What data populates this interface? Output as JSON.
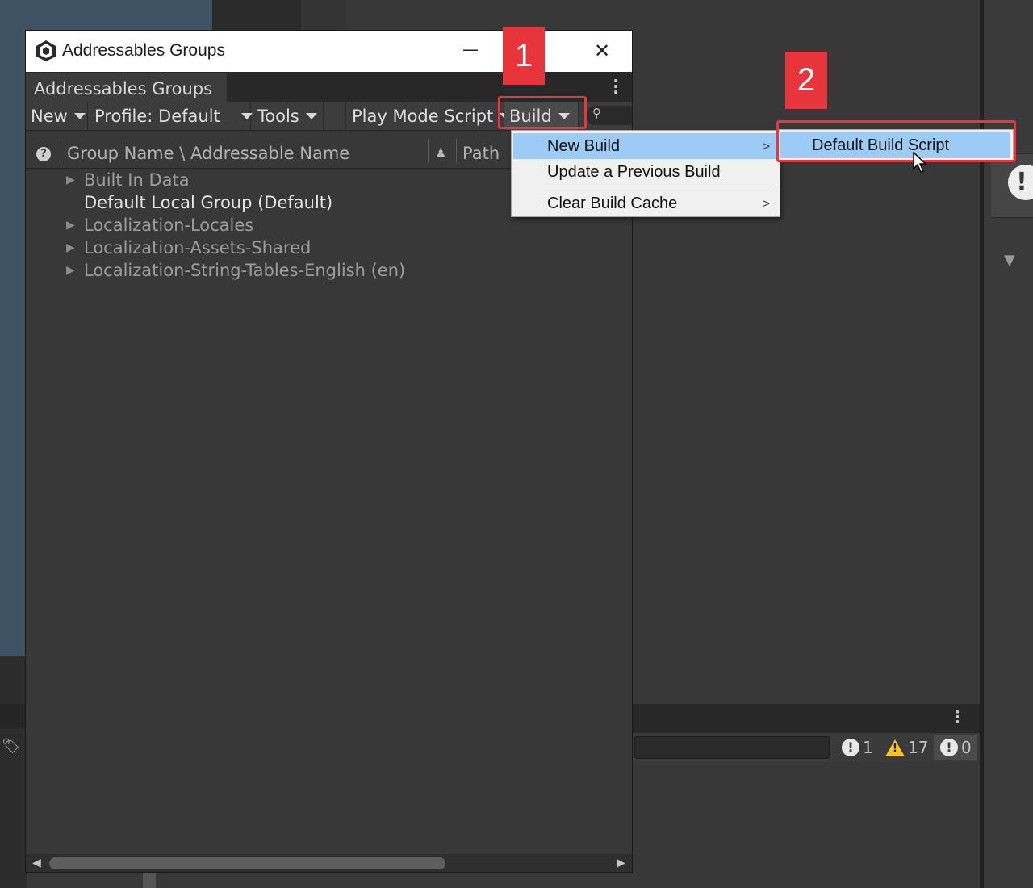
{
  "window": {
    "title": "Addressables Groups",
    "tab_label": "Addressables Groups"
  },
  "toolbar": {
    "new_label": "New",
    "profile_label": "Profile: Default",
    "tools_label": "Tools",
    "play_mode_label": "Play Mode Script",
    "build_label": "Build"
  },
  "columns": {
    "name": "Group Name \\ Addressable Name",
    "path": "Path"
  },
  "groups": [
    {
      "label": "Built In Data",
      "expandable": true
    },
    {
      "label": "Default Local Group (Default)",
      "expandable": false
    },
    {
      "label": "Localization-Locales",
      "expandable": true
    },
    {
      "label": "Localization-Assets-Shared",
      "expandable": true
    },
    {
      "label": "Localization-String-Tables-English (en)",
      "expandable": true
    }
  ],
  "build_menu": {
    "items": [
      {
        "label": "New Build",
        "highlighted": true,
        "has_submenu": true
      },
      {
        "label": "Update a Previous Build",
        "highlighted": false,
        "has_submenu": false
      },
      {
        "label": "Clear Build Cache",
        "highlighted": false,
        "has_submenu": true
      }
    ],
    "submenu_item": "Default Build Script"
  },
  "annotations": {
    "step1": "1",
    "step2": "2",
    "highlight_color": "#e8363c"
  },
  "console": {
    "errors": "1",
    "warnings": "17",
    "logs": "0"
  },
  "colors": {
    "menu_highlight": "#9ccbf5",
    "editor_bg": "#383838"
  }
}
